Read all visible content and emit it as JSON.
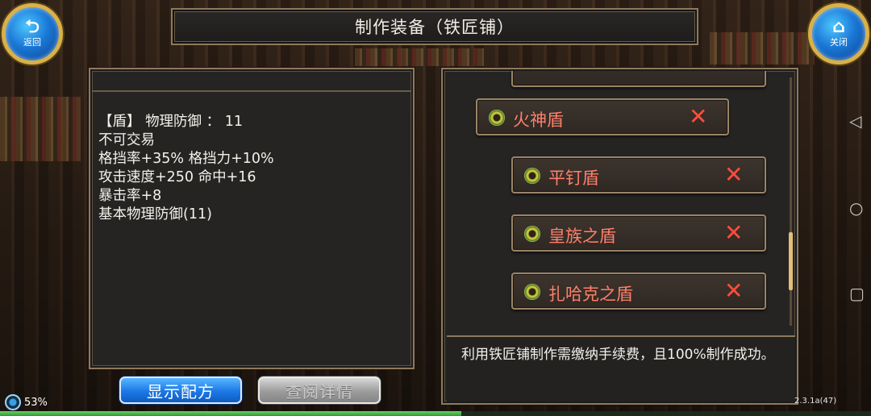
{
  "title": "制作装备（铁匠铺）",
  "back_button": {
    "label": "返回",
    "icon": "back-arrow-icon"
  },
  "close_button": {
    "label": "关闭",
    "icon": "home-icon"
  },
  "item_info": {
    "lines": [
      "【盾】 物理防御 ： 11",
      "不可交易",
      "格挡率+35% 格挡力+10%",
      "攻击速度+250 命中+16",
      "暴击率+8",
      "基本物理防御(11)"
    ]
  },
  "recipe_list": [
    {
      "name": "火神盾",
      "level": 0
    },
    {
      "name": "平钉盾",
      "level": 1
    },
    {
      "name": "皇族之盾",
      "level": 1
    },
    {
      "name": "扎哈克之盾",
      "level": 1
    }
  ],
  "description": "利用铁匠铺制作需缴纳手续费，且100%制作成功。",
  "buttons": {
    "show_recipe": "显示配方",
    "view_details": "查阅详情"
  },
  "status": {
    "battery": "53%",
    "version": "2.3.1a(47)",
    "progress": 0.53
  },
  "colors": {
    "accent_blue": "#1c78e6",
    "item_name": "#ff7f6a",
    "remove_x": "#ff4d3d",
    "frame": "#8e7a5c"
  }
}
